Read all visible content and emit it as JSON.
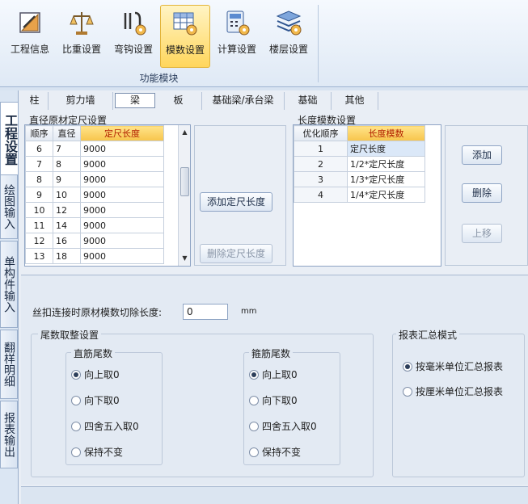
{
  "ribbon": {
    "buttons": [
      {
        "label": "工程信息",
        "icon": "ruler-triangle-icon"
      },
      {
        "label": "比重设置",
        "icon": "balance-scale-icon"
      },
      {
        "label": "弯钩设置",
        "icon": "hook-gear-icon"
      },
      {
        "label": "模数设置",
        "icon": "table-gear-icon",
        "active": true
      },
      {
        "label": "计算设置",
        "icon": "calculator-gear-icon"
      },
      {
        "label": "楼层设置",
        "icon": "floors-gear-icon"
      }
    ],
    "group_label": "功能模块"
  },
  "left_tabs": [
    "工程设置",
    "绘图输入",
    "单构件输入",
    "翻样明细",
    "报表输出"
  ],
  "top_tabs": [
    "柱",
    "剪力墙",
    "梁",
    "板",
    "基础梁/承台梁",
    "基础",
    "其他"
  ],
  "active_top_tab": "梁",
  "diameter_section": {
    "title": "直径原材定尺设置",
    "columns": [
      "顺序",
      "直径",
      "定尺长度"
    ],
    "rows": [
      [
        "6",
        "7",
        "9000"
      ],
      [
        "7",
        "8",
        "9000"
      ],
      [
        "8",
        "9",
        "9000"
      ],
      [
        "9",
        "10",
        "9000"
      ],
      [
        "10",
        "12",
        "9000"
      ],
      [
        "11",
        "14",
        "9000"
      ],
      [
        "12",
        "16",
        "9000"
      ],
      [
        "13",
        "18",
        "9000"
      ]
    ],
    "add_button": "添加定尺长度",
    "delete_button": "删除定尺长度"
  },
  "modulus_section": {
    "title": "长度模数设置",
    "columns": [
      "优化顺序",
      "长度模数"
    ],
    "rows": [
      [
        "1",
        "定尺长度"
      ],
      [
        "2",
        "1/2*定尺长度"
      ],
      [
        "3",
        "1/3*定尺长度"
      ],
      [
        "4",
        "1/4*定尺长度"
      ]
    ],
    "add_button": "添加",
    "delete_button": "删除",
    "up_button": "上移"
  },
  "cut_loss": {
    "label": "丝扣连接时原材模数切除长度:",
    "value": "0",
    "unit": "mm"
  },
  "tail_rounding": {
    "title": "尾数取整设置",
    "straight": {
      "title": "直筋尾数",
      "options": [
        "向上取0",
        "向下取0",
        "四舍五入取0",
        "保持不变"
      ],
      "selected": 0
    },
    "stirrup": {
      "title": "箍筋尾数",
      "options": [
        "向上取0",
        "向下取0",
        "四舍五入取0",
        "保持不变"
      ],
      "selected": 0
    }
  },
  "report_mode": {
    "title": "报表汇总模式",
    "options": [
      "按毫米单位汇总报表",
      "按厘米单位汇总报表"
    ],
    "selected": 0
  },
  "colors": {
    "header_highlight": "#f7c44b",
    "accent": "#ffd65c"
  }
}
